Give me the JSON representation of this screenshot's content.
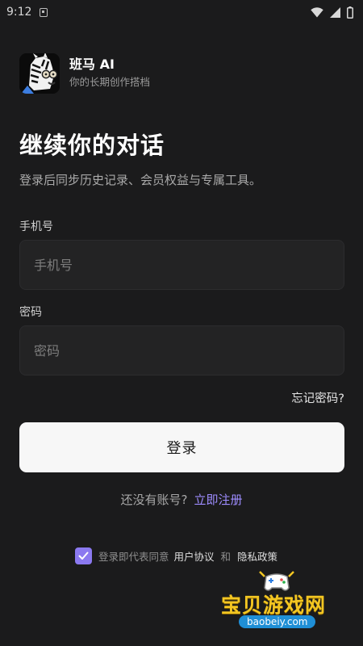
{
  "status_bar": {
    "time": "9:12"
  },
  "app": {
    "name": "班马 AI",
    "tagline": "你的长期创作搭档"
  },
  "page": {
    "title": "继续你的对话",
    "subtitle": "登录后同步历史记录、会员权益与专属工具。"
  },
  "phone": {
    "label": "手机号",
    "placeholder": "手机号"
  },
  "password": {
    "label": "密码",
    "placeholder": "密码"
  },
  "forgot_password": "忘记密码?",
  "login_button": "登录",
  "register": {
    "prompt": "还没有账号?",
    "link": "立即注册"
  },
  "agreement": {
    "checked": true,
    "text": "登录即代表同意",
    "user_agreement": "用户协议",
    "and": "和",
    "privacy_policy": "隐私政策"
  },
  "watermark": {
    "text": "宝贝游戏网",
    "domain": "baobeiy.com"
  },
  "colors": {
    "accent": "#8b79f0",
    "link": "#9e8cff",
    "background": "#1b1b1c"
  }
}
